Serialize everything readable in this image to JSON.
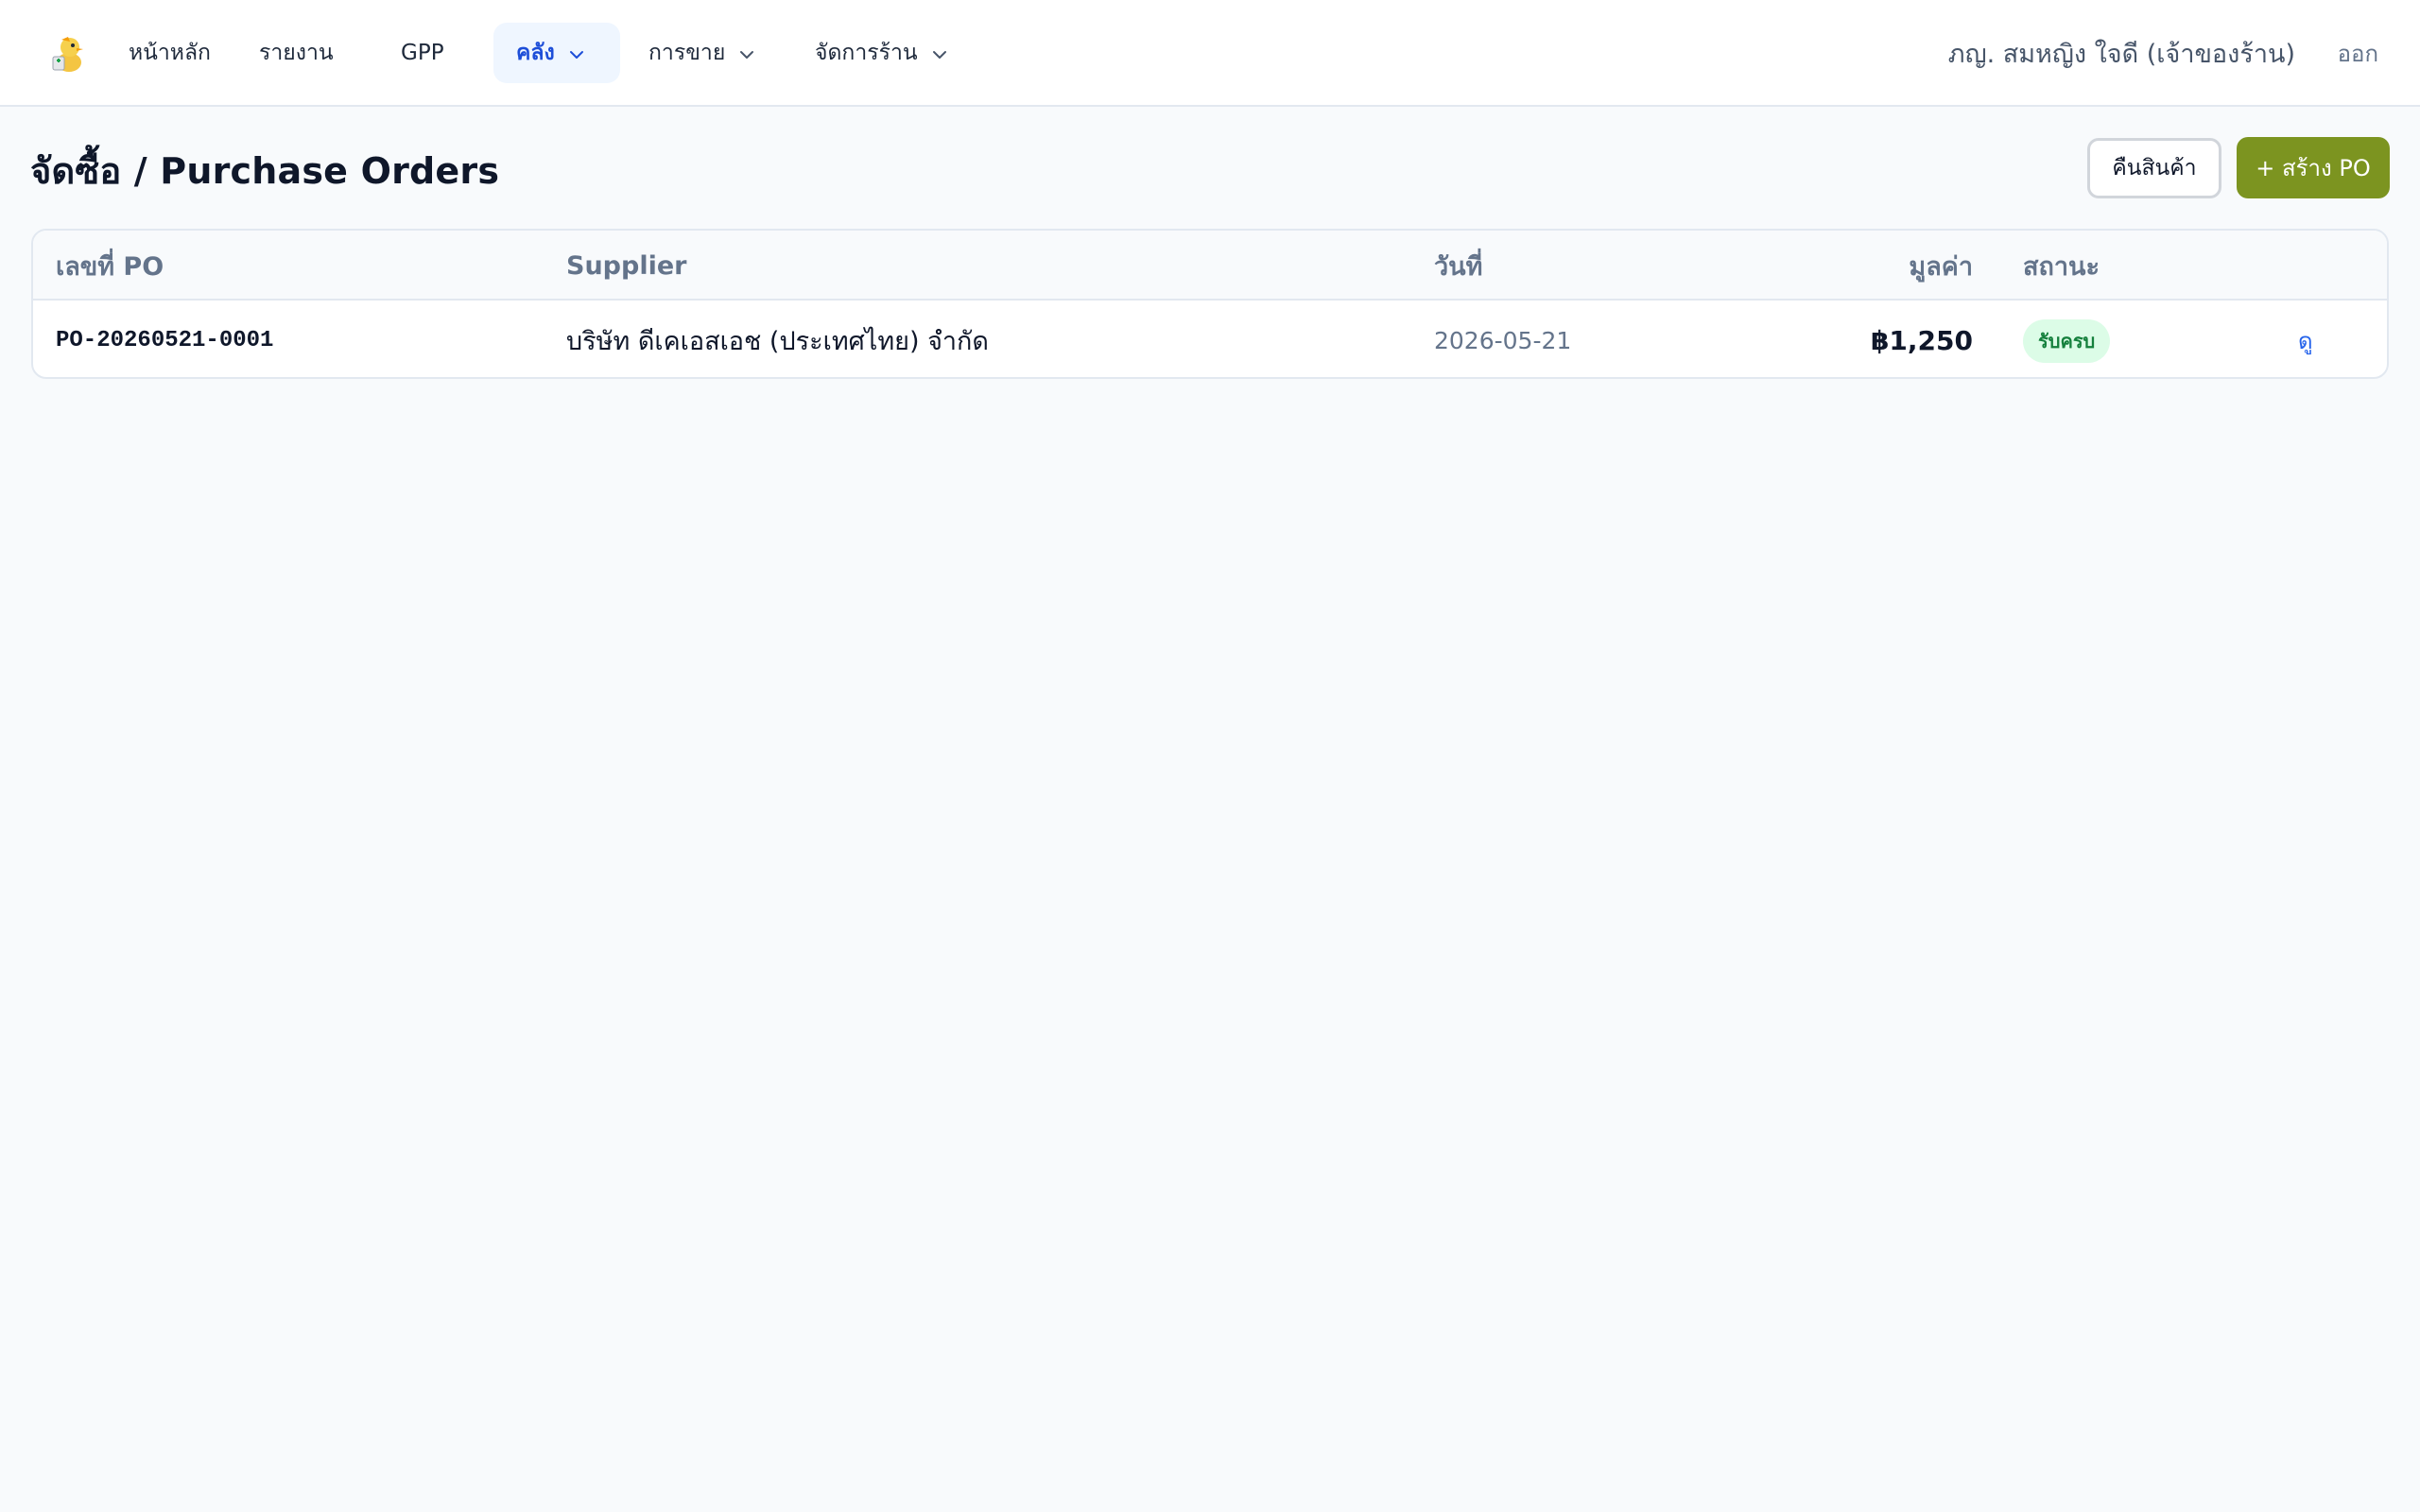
{
  "nav": {
    "logo_icon": "pharmacist-mascot-icon",
    "items": [
      {
        "label": "หน้าหลัก"
      },
      {
        "label": "รายงาน"
      },
      {
        "label": "GPP"
      },
      {
        "label": "คลัง"
      },
      {
        "label": "การขาย"
      },
      {
        "label": "จัดการร้าน"
      }
    ],
    "user": "ภญ. สมหญิง ใจดี (เจ้าของร้าน)",
    "logout": "ออก"
  },
  "page": {
    "title": "จัดซื้อ / Purchase Orders",
    "return_button": "คืนสินค้า",
    "create_button": "+ สร้าง PO"
  },
  "table": {
    "columns": {
      "po": "เลขที่ PO",
      "supplier": "Supplier",
      "date": "วันที่",
      "amount": "มูลค่า",
      "status": "สถานะ"
    },
    "rows": [
      {
        "po": "PO-20260521-0001",
        "supplier": "บริษัท ดีเคเอสเอช (ประเทศไทย) จำกัด",
        "date": "2026-05-21",
        "amount": "฿1,250",
        "status": "รับครบ",
        "action": "ดู"
      }
    ]
  },
  "colors": {
    "accent_active": "#1d4ed8",
    "create_button": "#7c9420",
    "status_badge_bg": "#dcfce7",
    "status_badge_text": "#15803d",
    "link": "#2563eb"
  }
}
